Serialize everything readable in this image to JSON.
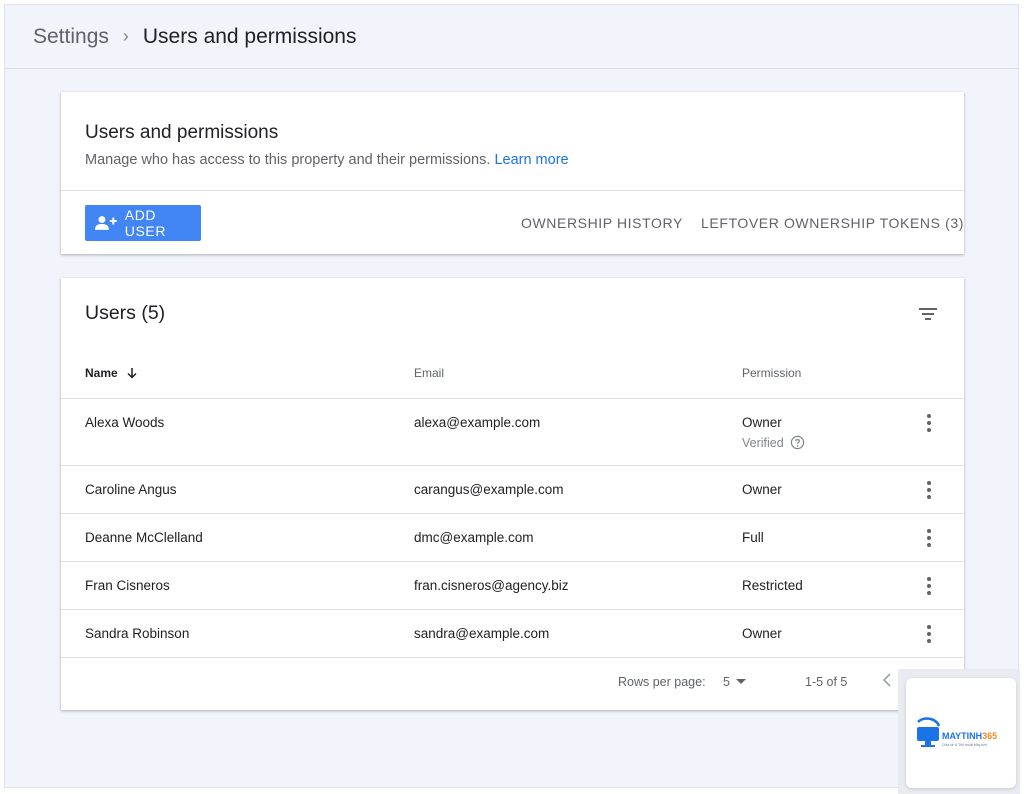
{
  "breadcrumb": {
    "root": "Settings",
    "separator": "›",
    "current": "Users and permissions"
  },
  "header_card": {
    "title": "Users and permissions",
    "description": "Manage who has access to this property and their permissions.",
    "learn_more": "Learn more",
    "add_user_label": "ADD USER",
    "ownership_history_label": "OWNERSHIP HISTORY",
    "leftover_tokens_label": "LEFTOVER OWNERSHIP TOKENS (3)"
  },
  "users_card": {
    "title": "Users (5)",
    "columns": {
      "name": "Name",
      "email": "Email",
      "permission": "Permission"
    },
    "rows": [
      {
        "name": "Alexa Woods",
        "email": "alexa@example.com",
        "permission": "Owner",
        "sub": "Verified"
      },
      {
        "name": "Caroline Angus",
        "email": "carangus@example.com",
        "permission": "Owner"
      },
      {
        "name": "Deanne McClelland",
        "email": "dmc@example.com",
        "permission": "Full"
      },
      {
        "name": "Fran Cisneros",
        "email": "fran.cisneros@agency.biz",
        "permission": "Restricted"
      },
      {
        "name": "Sandra Robinson",
        "email": "sandra@example.com",
        "permission": "Owner"
      }
    ],
    "footer": {
      "rows_per_page_label": "Rows per page:",
      "rows_per_page_value": "5",
      "range": "1-5 of 5"
    }
  },
  "watermark": {
    "brand_a": "MAYTINH",
    "brand_b": "365",
    "tagline": "Chia sẻ & Thủ thuật Máy tính"
  },
  "colors": {
    "accent": "#4285f4",
    "link": "#1a73e8",
    "background": "#f1f4fa"
  },
  "icons": [
    "chevron-right-icon",
    "add-user-icon",
    "filter-icon",
    "arrow-down-icon",
    "help-icon",
    "more-vert-icon",
    "dropdown-arrow-icon",
    "chevron-left-icon"
  ]
}
